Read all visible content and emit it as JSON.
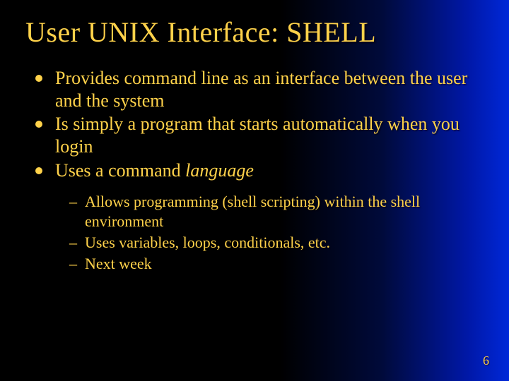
{
  "title": "User UNIX Interface: SHELL",
  "bullets": [
    {
      "text": "Provides command line as an interface between the user and the system"
    },
    {
      "text": "Is simply a program that starts automatically when you login"
    },
    {
      "prefix": "Uses a command ",
      "italic": "language"
    }
  ],
  "subbullets": [
    "Allows programming (shell scripting) within the shell environment",
    "Uses variables, loops, conditionals, etc.",
    "Next week"
  ],
  "pageNumber": "6"
}
